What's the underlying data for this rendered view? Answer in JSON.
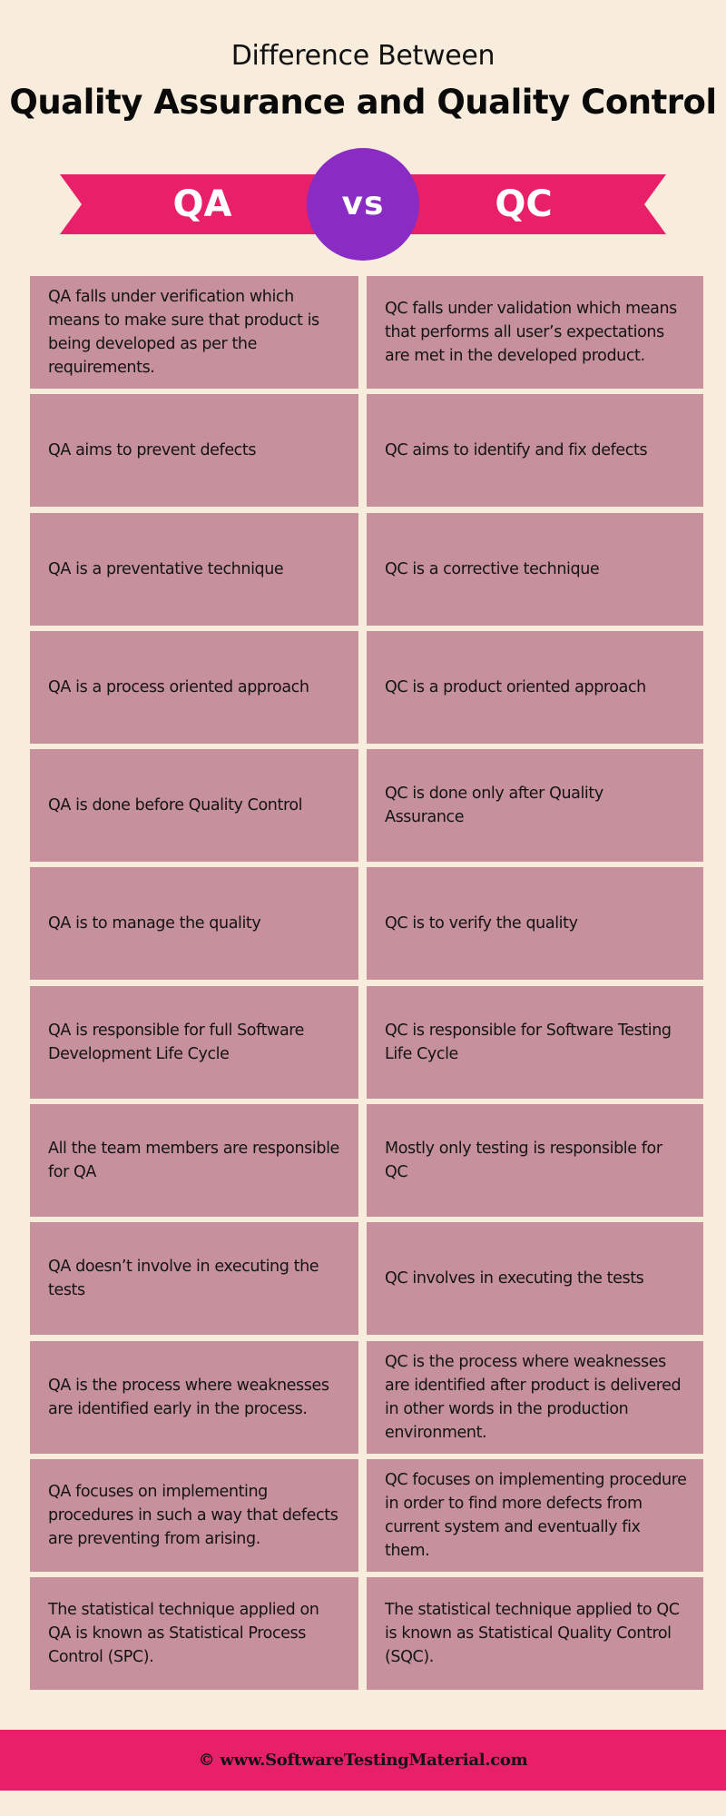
{
  "header": {
    "subtitle": "Difference Between",
    "title": "Quality Assurance and Quality Control"
  },
  "banner": {
    "left_label": "QA",
    "vs_label": "vs",
    "right_label": "QC"
  },
  "colors": {
    "background": "#F8ECDD",
    "banner": "#E8206A",
    "vs_circle": "#8A2BC4",
    "cell": "#C6909C",
    "footer": "#E8206A"
  },
  "comparison": {
    "rows": [
      {
        "qa": "QA falls under verification which means to make sure that product is being developed as per the requirements.",
        "qc": "QC falls under validation which means that performs all user’s expectations are met in the developed product."
      },
      {
        "qa": "QA aims to prevent defects",
        "qc": "QC aims to identify and fix defects"
      },
      {
        "qa": "QA is a preventative technique",
        "qc": "QC is a corrective technique"
      },
      {
        "qa": "QA is a process oriented approach",
        "qc": "QC is a product oriented approach"
      },
      {
        "qa": "QA is done before Quality Control",
        "qc": "QC is done only after Quality Assurance"
      },
      {
        "qa": "QA is to manage the quality",
        "qc": "QC is to verify the quality"
      },
      {
        "qa": "QA is responsible for full Software Development Life Cycle",
        "qc": "QC is responsible for Software Testing Life Cycle"
      },
      {
        "qa": "All the team members are responsible for QA",
        "qc": "Mostly only testing is responsible for QC"
      },
      {
        "qa": "QA doesn’t involve in executing the tests",
        "qc": "QC involves in executing the tests"
      },
      {
        "qa": "QA is the process where weaknesses are identified early in the process.",
        "qc": "QC is the process where weaknesses are identified after product is delivered in other words in the production environment."
      },
      {
        "qa": "QA focuses on implementing procedures in such a way that defects are preventing from arising.",
        "qc": "QC focuses on implementing procedure in order to find more defects from current system and eventually fix them."
      },
      {
        "qa": "The statistical technique applied on QA is known as Statistical Process Control (SPC).",
        "qc": "The statistical technique applied to QC is known as Statistical Quality Control (SQC)."
      }
    ]
  },
  "footer": {
    "text": "© www.SoftwareTestingMaterial.com"
  }
}
